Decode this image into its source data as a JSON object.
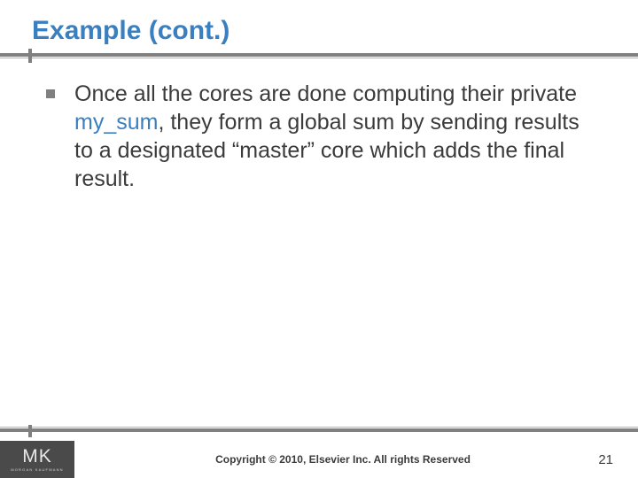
{
  "title": "Example (cont.)",
  "bullets": [
    {
      "pre": "Once all the cores are done computing their private ",
      "highlight": "my_sum",
      "post": ", they form a global sum by sending results to a designated “master” core which adds the final result."
    }
  ],
  "footer": {
    "logo_main": "MK",
    "logo_sub": "MORGAN KAUFMANN",
    "copyright": "Copyright © 2010, Elsevier Inc. All rights Reserved",
    "page": "21"
  }
}
